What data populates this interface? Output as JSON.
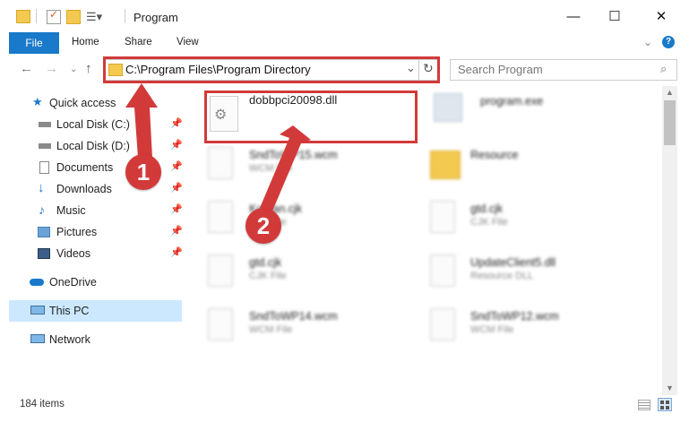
{
  "window": {
    "title": "Program"
  },
  "ribbon": {
    "file": "File",
    "home": "Home",
    "share": "Share",
    "view": "View"
  },
  "address": {
    "path": "C:\\Program Files\\Program Directory"
  },
  "search": {
    "placeholder": "Search Program"
  },
  "sidebar": {
    "items": [
      {
        "label": "Quick access",
        "icon": "star-icon",
        "pinned": false
      },
      {
        "label": "Local Disk (C:)",
        "icon": "drive-icon",
        "pinned": true
      },
      {
        "label": "Local Disk (D:)",
        "icon": "drive-icon",
        "pinned": true
      },
      {
        "label": "Documents",
        "icon": "documents-icon",
        "pinned": true
      },
      {
        "label": "Downloads",
        "icon": "download-icon",
        "pinned": true
      },
      {
        "label": "Music",
        "icon": "music-icon",
        "pinned": true
      },
      {
        "label": "Pictures",
        "icon": "pictures-icon",
        "pinned": true
      },
      {
        "label": "Videos",
        "icon": "videos-icon",
        "pinned": true
      },
      {
        "label": "OneDrive",
        "icon": "cloud-icon",
        "pinned": false
      },
      {
        "label": "This PC",
        "icon": "computer-icon",
        "pinned": false,
        "selected": true
      },
      {
        "label": "Network",
        "icon": "network-icon",
        "pinned": false
      }
    ]
  },
  "files": [
    {
      "name": "dobbpci20098.dll",
      "type": ""
    },
    {
      "name": "program.exe",
      "type": ""
    },
    {
      "name": "SndToWP15.wcm",
      "type": "WCM File"
    },
    {
      "name": "Resource",
      "type": ""
    },
    {
      "name": "Korean.cjk",
      "type": "CJK File"
    },
    {
      "name": "gtd.cjk",
      "type": "CJK File"
    },
    {
      "name": "gtd.cjk",
      "type": "CJK File"
    },
    {
      "name": "UpdateClient5.dll",
      "type": "Resource DLL"
    },
    {
      "name": "SndToWP14.wcm",
      "type": "WCM File"
    },
    {
      "name": "SndToWP12.wcm",
      "type": "WCM File"
    }
  ],
  "annotations": {
    "step1": "1",
    "step2": "2"
  },
  "status": {
    "count": "184 items"
  },
  "colors": {
    "accent": "#1979ca",
    "annotation": "#d23a3a",
    "selection": "#cce8ff"
  }
}
